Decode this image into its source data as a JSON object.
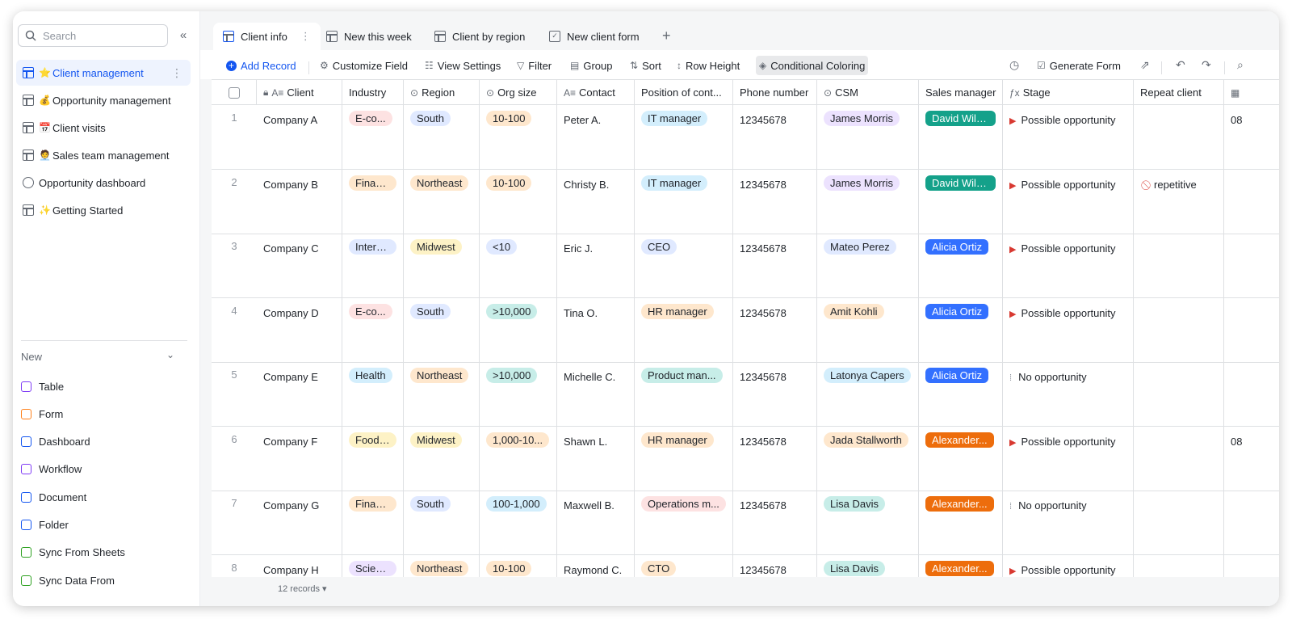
{
  "sidebar": {
    "search_placeholder": "Search",
    "items": [
      {
        "label": "Client management",
        "emoji": "⭐",
        "active": true
      },
      {
        "label": "Opportunity management",
        "emoji": "💰",
        "active": false
      },
      {
        "label": "Client visits",
        "emoji": "📅",
        "active": false
      },
      {
        "label": "Sales team management",
        "emoji": "🧑‍💼",
        "active": false
      },
      {
        "label": "Opportunity dashboard",
        "emoji": "",
        "active": false
      },
      {
        "label": " Getting Started",
        "emoji": "✨",
        "active": false
      }
    ],
    "new_section_label": "New",
    "new_items": [
      {
        "label": "Table",
        "color": "#7f3bf5"
      },
      {
        "label": "Form",
        "color": "#ff811a"
      },
      {
        "label": "Dashboard",
        "color": "#1456f0"
      },
      {
        "label": "Workflow",
        "color": "#7f3bf5"
      },
      {
        "label": "Document",
        "color": "#1456f0"
      },
      {
        "label": "Folder",
        "color": "#1456f0"
      },
      {
        "label": "Sync From Sheets",
        "color": "#2ea121"
      },
      {
        "label": "Sync Data From",
        "color": "#2ea121"
      }
    ]
  },
  "tabs": [
    {
      "label": "Client info",
      "icon": "table-icon",
      "active": true
    },
    {
      "label": "New this week",
      "icon": "grid-icon",
      "active": false
    },
    {
      "label": "Client by region",
      "icon": "grid-icon",
      "active": false
    },
    {
      "label": "New client form",
      "icon": "form-icon",
      "active": false
    }
  ],
  "toolbar": {
    "add_record": "Add Record",
    "customize_field": "Customize Field",
    "view_settings": "View Settings",
    "filter": "Filter",
    "group": "Group",
    "sort": "Sort",
    "row_height": "Row Height",
    "conditional_coloring": "Conditional Coloring",
    "generate_form": "Generate Form"
  },
  "columns": [
    "Client",
    "Industry",
    "Region",
    "Org size",
    "Contact",
    "Position of cont...",
    "Phone number",
    "CSM",
    "Sales manager",
    "Stage",
    "Repeat client"
  ],
  "rows": [
    {
      "num": "1",
      "client": "Company A",
      "industry": "E-co...",
      "region": "South",
      "org_size": "10-100",
      "contact": "Peter A.",
      "position": "IT manager",
      "phone": "12345678",
      "csm": "James Morris",
      "sales": "David Wils...",
      "stage": "Possible opportunity",
      "repeat": "",
      "extra": "08"
    },
    {
      "num": "2",
      "client": "Company B",
      "industry": "Finance",
      "region": "Northeast",
      "org_size": "10-100",
      "contact": "Christy B.",
      "position": "IT manager",
      "phone": "12345678",
      "csm": "James Morris",
      "sales": "David Wils...",
      "stage": "Possible opportunity",
      "repeat": "repetitive",
      "extra": ""
    },
    {
      "num": "3",
      "client": "Company C",
      "industry": "Intern...",
      "region": "Midwest",
      "org_size": "<10",
      "contact": "Eric J.",
      "position": "CEO",
      "phone": "12345678",
      "csm": "Mateo Perez",
      "sales": "Alicia Ortiz",
      "stage": "Possible opportunity",
      "repeat": "",
      "extra": ""
    },
    {
      "num": "4",
      "client": "Company D",
      "industry": "E-co...",
      "region": "South",
      "org_size": ">10,000",
      "contact": "Tina O.",
      "position": "HR manager",
      "phone": "12345678",
      "csm": "Amit Kohli",
      "sales": "Alicia Ortiz",
      "stage": "Possible opportunity",
      "repeat": "",
      "extra": ""
    },
    {
      "num": "5",
      "client": "Company E",
      "industry": "Health",
      "region": "Northeast",
      "org_size": ">10,000",
      "contact": "Michelle C.",
      "position": "Product man...",
      "phone": "12345678",
      "csm": "Latonya Capers",
      "sales": "Alicia Ortiz",
      "stage": "No opportunity",
      "repeat": "",
      "extra": ""
    },
    {
      "num": "6",
      "client": "Company F",
      "industry": "Food ...",
      "region": "Midwest",
      "org_size": "1,000-10...",
      "contact": "Shawn L.",
      "position": "HR manager",
      "phone": "12345678",
      "csm": "Jada Stallworth",
      "sales": "Alexander...",
      "stage": "Possible opportunity",
      "repeat": "",
      "extra": "08"
    },
    {
      "num": "7",
      "client": "Company G",
      "industry": "Finance",
      "region": "South",
      "org_size": "100-1,000",
      "contact": "Maxwell B.",
      "position": "Operations m...",
      "phone": "12345678",
      "csm": "Lisa Davis",
      "sales": "Alexander...",
      "stage": "No opportunity",
      "repeat": "",
      "extra": ""
    },
    {
      "num": "8",
      "client": "Company H",
      "industry": "Scien...",
      "region": "Northeast",
      "org_size": "10-100",
      "contact": "Raymond C.",
      "position": "CTO",
      "phone": "12345678",
      "csm": "Lisa Davis",
      "sales": "Alexander...",
      "stage": "Possible opportunity",
      "repeat": "",
      "extra": ""
    }
  ],
  "tag_colors": {
    "industry": {
      "E-co...": "#fde2e2",
      "Finance": "#fee7cd",
      "Intern...": "#e0e9ff",
      "Health": "#d3eefc",
      "Food ...": "#fdf2c6",
      "Scien...": "#ece2fe"
    },
    "region": {
      "South": "#e0e9ff",
      "Northeast": "#fee7cd",
      "Midwest": "#fdf2c6"
    },
    "org_size": {
      "10-100": "#fee7cd",
      "<10": "#e0e9ff",
      ">10,000": "#c7ede8",
      "1,000-10...": "#fee7cd",
      "100-1,000": "#d3eefc"
    },
    "position": {
      "IT manager": "#d3eefc",
      "CEO": "#e0e9ff",
      "HR manager": "#fee7cd",
      "Product man...": "#c7ede8",
      "Operations m...": "#fde2e2",
      "CTO": "#fee7cd"
    },
    "csm": {
      "James Morris": "#ece2fe",
      "Mateo Perez": "#e0e9ff",
      "Amit Kohli": "#fee7cd",
      "Latonya Capers": "#d3eefc",
      "Jada Stallworth": "#fee7cd",
      "Lisa Davis": "#c7ede8"
    },
    "sales": {
      "David Wils...": "#14a18a",
      "Alicia Ortiz": "#3370ff",
      "Alexander...": "#ed6d0c"
    }
  },
  "footer": {
    "records": "12 records"
  }
}
